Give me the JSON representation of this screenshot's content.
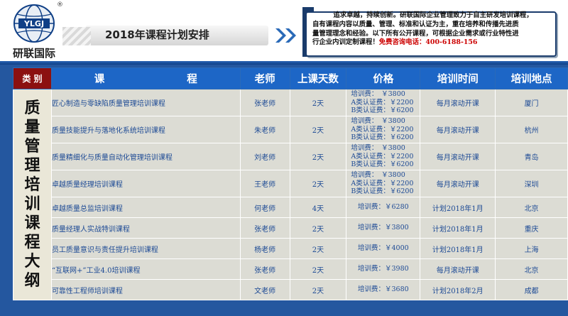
{
  "brand": {
    "logo_letters": "YLGJ",
    "name": "研联国际",
    "reg": "®"
  },
  "header": {
    "title": "2018年课程计划安排"
  },
  "notice": {
    "lines": [
      "追求卓越，持续创新。研联国际企业管理致力于自主研发培训课程，",
      "自有课程内容以质量、管理、标准和认证为主，重在培养和传播先进质",
      "量管理理念和经验。以下所有公开课程，可根据企业需求或行业特性进",
      "行企业内训定制课程！"
    ],
    "phone": "免费咨询电话：400-6188-156"
  },
  "table": {
    "headers": [
      "类 别",
      "课　　　　　　　　程",
      "老师",
      "上课天数",
      "价格",
      "培训时间",
      "培训地点"
    ],
    "category": "质量管理培训课程大纲",
    "rows": [
      {
        "course": "匠心制造与零缺陷质量管理培训课程",
        "teacher": "张老师",
        "days": "2天",
        "prices": [
          "培训费：　￥3800",
          "A类认证费：￥2200",
          "B类认证费：￥6200"
        ],
        "time": "每月滚动开课",
        "place": "厦门"
      },
      {
        "course": "质量技能提升与落地化系统培训课程",
        "teacher": "朱老师",
        "days": "2天",
        "prices": [
          "培训费：　￥3800",
          "A类认证费：￥2200",
          "B类认证费：￥6200"
        ],
        "time": "每月滚动开课",
        "place": "杭州"
      },
      {
        "course": "质量精细化与质量自动化管理培训课程",
        "teacher": "刘老师",
        "days": "2天",
        "prices": [
          "培训费：　￥3800",
          "A类认证费：￥2200",
          "B类认证费：￥6200"
        ],
        "time": "每月滚动开课",
        "place": "青岛"
      },
      {
        "course": "卓越质量经理培训课程",
        "teacher": "王老师",
        "days": "2天",
        "prices": [
          "培训费：　￥3800",
          "A类认证费：￥2200",
          "B类认证费：￥6200"
        ],
        "time": "每月滚动开课",
        "place": "深圳"
      },
      {
        "course": "卓越质量总监培训课程",
        "teacher": "何老师",
        "days": "4天",
        "prices": [
          "培训费：￥6280"
        ],
        "time": "计划2018年1月",
        "place": "北京"
      },
      {
        "course": "质量经理人实战特训课程",
        "teacher": "张老师",
        "days": "2天",
        "prices": [
          "培训费：￥3800"
        ],
        "time": "计划2018年1月",
        "place": "重庆"
      },
      {
        "course": "员工质量意识与责任提升培训课程",
        "teacher": "杨老师",
        "days": "2天",
        "prices": [
          "培训费：￥4000"
        ],
        "time": "计划2018年1月",
        "place": "上海"
      },
      {
        "course": "“互联网+”工业4.0培训课程",
        "teacher": "张老师",
        "days": "2天",
        "prices": [
          "培训费：￥3980"
        ],
        "time": "每月滚动开课",
        "place": "北京"
      },
      {
        "course": "可靠性工程师培训课程",
        "teacher": "文老师",
        "days": "2天",
        "prices": [
          "培训费：￥3680"
        ],
        "time": "计划2018年2月",
        "place": "成都"
      }
    ]
  }
}
